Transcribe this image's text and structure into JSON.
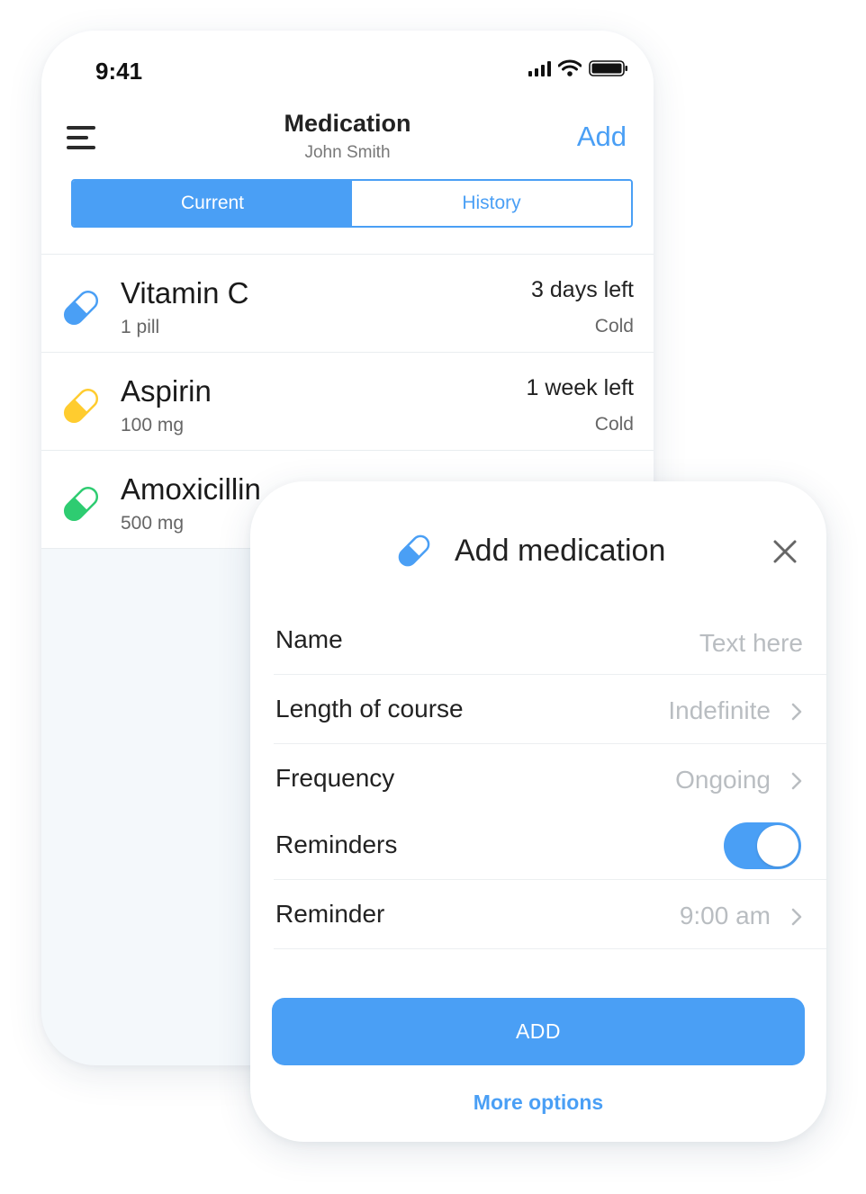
{
  "status_bar": {
    "time": "9:41"
  },
  "nav": {
    "title": "Medication",
    "subtitle": "John Smith",
    "add_label": "Add"
  },
  "segments": {
    "current_label": "Current",
    "history_label": "History"
  },
  "medications": [
    {
      "name": "Vitamin C",
      "dose": "1 pill",
      "remaining": "3 days left",
      "tag": "Cold",
      "color": "#4a9ff5"
    },
    {
      "name": "Aspirin",
      "dose": "100 mg",
      "remaining": "1 week left",
      "tag": "Cold",
      "color": "#ffcc2f"
    },
    {
      "name": "Amoxicillin",
      "dose": "500 mg",
      "remaining": "",
      "tag": "",
      "color": "#2ecc71"
    }
  ],
  "modal": {
    "title": "Add medication",
    "fields": {
      "name_label": "Name",
      "name_placeholder": "Text here",
      "course_label": "Length of course",
      "course_value": "Indefinite",
      "frequency_label": "Frequency",
      "frequency_value": "Ongoing",
      "reminders_label": "Reminders",
      "reminders_on": true,
      "reminder_label": "Reminder",
      "reminder_value": "9:00 am"
    },
    "add_button": "ADD",
    "more_options": "More options"
  },
  "colors": {
    "accent": "#4a9ff5",
    "background": "#f4f8fb"
  }
}
